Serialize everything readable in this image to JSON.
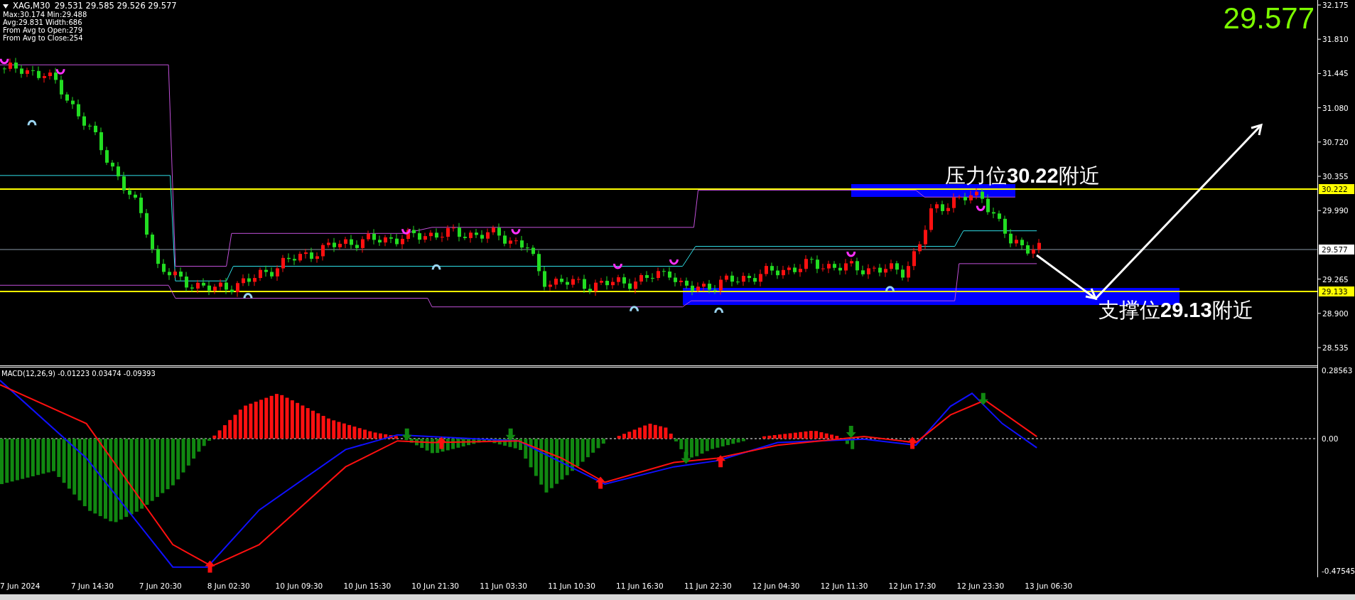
{
  "header": {
    "symbol": "XAG,M30",
    "quote": "29.531 29.585 29.526 29.577"
  },
  "stats": [
    "Max:30.174 Min:29.488",
    "Avg:29.831 Width:686",
    "From Avg to Open:279",
    "From Avg to Close:254"
  ],
  "big_price": "29.577",
  "annotations": [
    {
      "kind": "resistance",
      "text": "压力位**30.22**附近"
    },
    {
      "kind": "support",
      "text": "支撑位**29.13**附近"
    }
  ],
  "price_axis": {
    "ticks": [
      "32.175",
      "31.810",
      "31.445",
      "31.080",
      "30.720",
      "30.355",
      "29.990",
      "29.265",
      "28.900",
      "28.535"
    ],
    "markers": [
      {
        "kind": "resistance",
        "label": "30.222"
      },
      {
        "kind": "bid",
        "label": "29.577"
      },
      {
        "kind": "support",
        "label": "29.133"
      }
    ]
  },
  "macd": {
    "label": "MACD(12,26,9) -0.01223 0.03474 -0.09393",
    "ticks": [
      "0.28563",
      "0.00",
      "-0.47545"
    ]
  },
  "time_axis": [
    "7 Jun 2024",
    "7 Jun 14:30",
    "7 Jun 20:30",
    "8 Jun 02:30",
    "10 Jun 09:30",
    "10 Jun 15:30",
    "10 Jun 21:30",
    "11 Jun 03:30",
    "11 Jun 10:30",
    "11 Jun 16:30",
    "11 Jun 22:30",
    "12 Jun 04:30",
    "12 Jun 11:30",
    "12 Jun 17:30",
    "12 Jun 23:30",
    "13 Jun 06:30"
  ]
}
